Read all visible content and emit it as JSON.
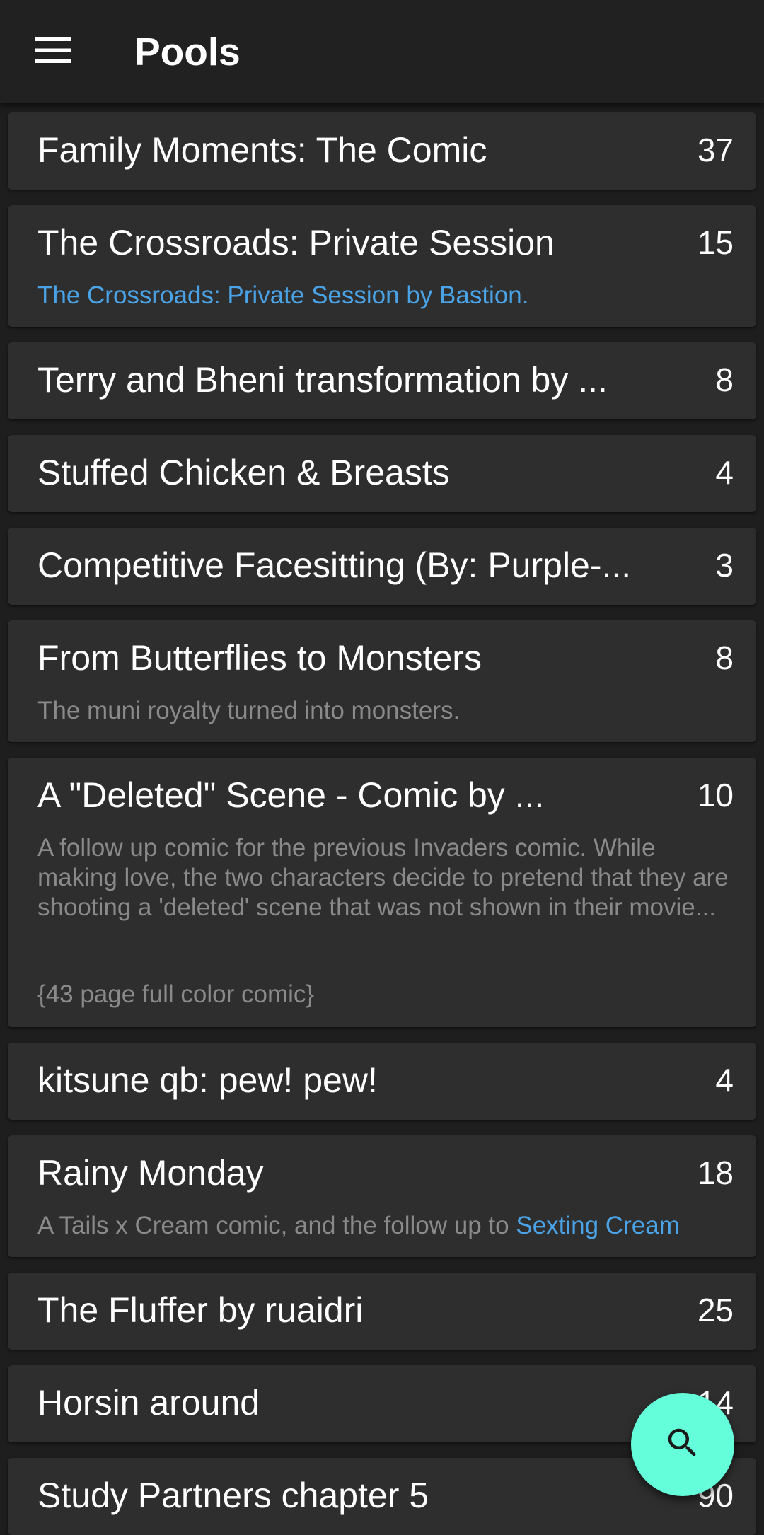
{
  "appbar": {
    "title": "Pools",
    "menu_icon": "hamburger-menu-icon"
  },
  "pools": [
    {
      "title": "Family Moments: The Comic",
      "count": "37"
    },
    {
      "title": "The Crossroads: Private Session",
      "count": "15",
      "desc_link": "The Crossroads: Private Session by Bastion."
    },
    {
      "title": "Terry and Bheni transformation by ...",
      "count": "8"
    },
    {
      "title": "Stuffed Chicken & Breasts",
      "count": "4"
    },
    {
      "title": "Competitive Facesitting (By: Purple-...",
      "count": "3"
    },
    {
      "title": "From Butterflies to Monsters",
      "count": "8",
      "desc": "The muni royalty turned into monsters."
    },
    {
      "title": "A \"Deleted\" Scene - Comic by ...",
      "count": "10",
      "desc": "A follow up comic for the previous Invaders comic. While making love, the two characters decide to pretend that they are shooting a 'deleted' scene that was not shown in their movie...",
      "desc2": "{43 page full color comic}"
    },
    {
      "title": "kitsune qb: pew! pew!",
      "count": "4"
    },
    {
      "title": "Rainy Monday",
      "count": "18",
      "desc": "A Tails x Cream comic, and the follow up to ",
      "desc_link": "Sexting Cream"
    },
    {
      "title": "The Fluffer by ruaidri",
      "count": "25"
    },
    {
      "title": "Horsin around",
      "count": "14"
    },
    {
      "title": "Study Partners chapter 5",
      "count": "90"
    }
  ],
  "fab": {
    "icon": "search-icon"
  },
  "colors": {
    "background": "#1e1e1e",
    "card": "#2e2e2e",
    "appbar": "#212121",
    "link": "#4aa3e6",
    "fab": "#64ffda"
  }
}
